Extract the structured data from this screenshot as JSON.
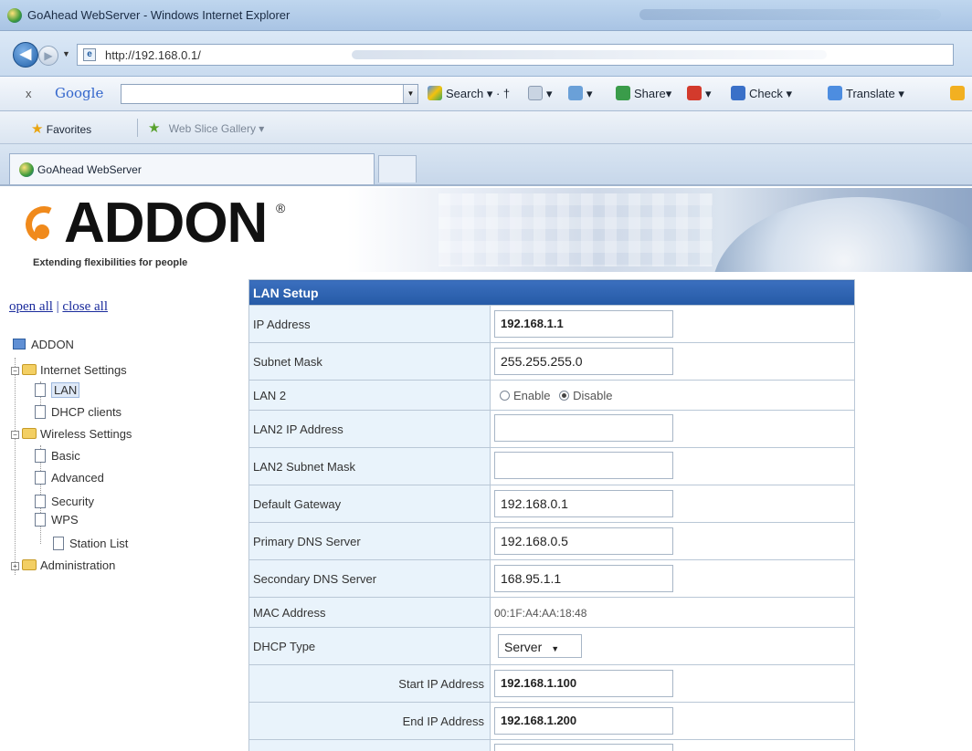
{
  "browser": {
    "window_title": "GoAhead WebServer - Windows Internet Explorer",
    "url": "http://192.168.0.1/",
    "toolbar": {
      "close": "x",
      "google": "Google",
      "search_label": "Search",
      "share_label": "Share",
      "check_label": "Check",
      "translate_label": "Translate"
    },
    "favorites_label": "Favorites",
    "web_slice_gallery": "Web Slice Gallery",
    "tab_title": "GoAhead WebServer"
  },
  "header": {
    "logo_text": "ADDON",
    "logo_mark": "®",
    "tagline": "Extending flexibilities for people"
  },
  "sidebar": {
    "open_all": "open all",
    "separator": "|",
    "close_all": "close all",
    "root": "ADDON",
    "items": [
      {
        "label": "Internet Settings",
        "type": "folder"
      },
      {
        "label": "LAN",
        "type": "page"
      },
      {
        "label": "DHCP clients",
        "type": "page"
      },
      {
        "label": "Wireless Settings",
        "type": "folder"
      },
      {
        "label": "Basic",
        "type": "page"
      },
      {
        "label": "Advanced",
        "type": "page"
      },
      {
        "label": "Security",
        "type": "page"
      },
      {
        "label": "WPS",
        "type": "page"
      },
      {
        "label": "Station List",
        "type": "page"
      },
      {
        "label": "Administration",
        "type": "folder"
      }
    ]
  },
  "lan": {
    "title": "LAN Setup",
    "rows": {
      "ip_label": "IP Address",
      "ip_value": "192.168.1.1",
      "subnet_label": "Subnet Mask",
      "subnet_value": "255.255.255.0",
      "lan2_label": "LAN 2",
      "lan2_enable": "Enable",
      "lan2_disable": "Disable",
      "lan2_ip_label": "LAN2 IP Address",
      "lan2_ip_value": "",
      "lan2_subnet_label": "LAN2 Subnet Mask",
      "lan2_subnet_value": "",
      "gateway_label": "Default Gateway",
      "gateway_value": "192.168.0.1",
      "dns1_label": "Primary DNS Server",
      "dns1_value": "192.168.0.5",
      "dns2_label": "Secondary DNS Server",
      "dns2_value": "168.95.1.1",
      "mac_label": "MAC Address",
      "mac_value": "00:1F:A4:AA:18:48",
      "dhcp_label": "DHCP Type",
      "dhcp_value": "Server",
      "start_label": "Start IP Address",
      "start_value": "192.168.1.100",
      "end_label": "End IP Address",
      "end_value": "192.168.1.200"
    }
  }
}
